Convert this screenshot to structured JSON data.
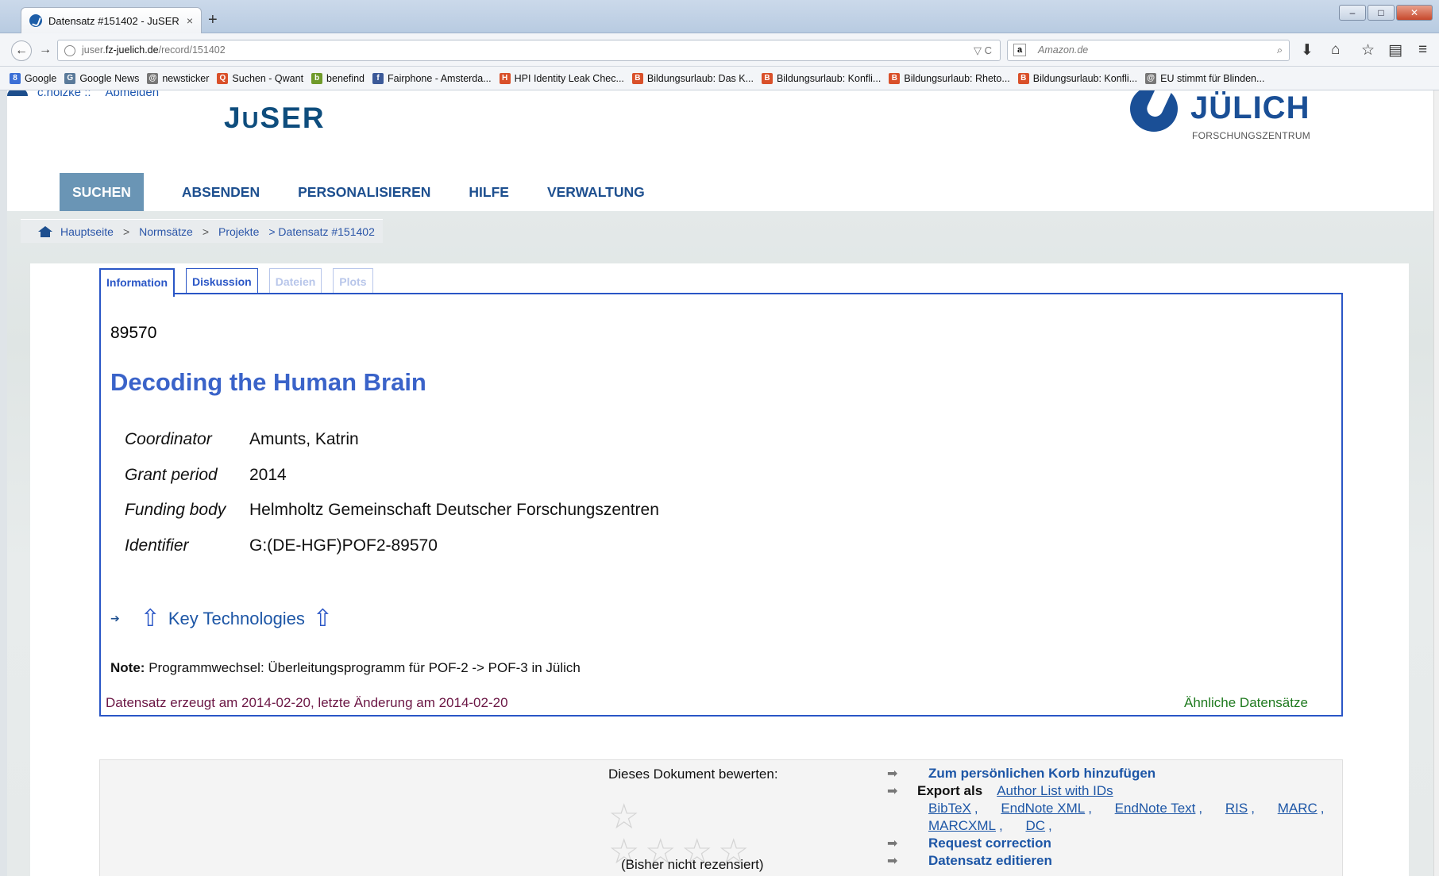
{
  "browser": {
    "tab_title": "Datensatz #151402 - JuSER",
    "tab_close": "×",
    "new_tab": "+",
    "url_prefix": "juser.",
    "url_host": "fz-juelich.de",
    "url_path": "/record/151402",
    "url_tools": "▽ C",
    "search_placeholder": "Amazon.de",
    "search_engine_glyph": "a",
    "win_min": "–",
    "win_max": "□",
    "win_close": "✕"
  },
  "bookmarks": [
    {
      "label": "Google",
      "color": "#3b6fd6",
      "glyph": "8"
    },
    {
      "label": "Google News",
      "color": "#5a7a9a",
      "glyph": "G"
    },
    {
      "label": "newsticker",
      "color": "#777777",
      "glyph": "@"
    },
    {
      "label": "Suchen - Qwant",
      "color": "#d9502a",
      "glyph": "Q"
    },
    {
      "label": "benefind",
      "color": "#6f9a2a",
      "glyph": "b"
    },
    {
      "label": "Fairphone - Amsterda...",
      "color": "#3b5998",
      "glyph": "f"
    },
    {
      "label": "HPI Identity Leak Chec...",
      "color": "#d9502a",
      "glyph": "H"
    },
    {
      "label": "Bildungsurlaub: Das K...",
      "color": "#d9502a",
      "glyph": "B"
    },
    {
      "label": "Bildungsurlaub: Konfli...",
      "color": "#d9502a",
      "glyph": "B"
    },
    {
      "label": "Bildungsurlaub: Rheto...",
      "color": "#d9502a",
      "glyph": "B"
    },
    {
      "label": "Bildungsurlaub: Konfli...",
      "color": "#d9502a",
      "glyph": "B"
    },
    {
      "label": "EU stimmt für Blinden...",
      "color": "#777777",
      "glyph": "@"
    }
  ],
  "header": {
    "user_name": "c.holzke ::",
    "logout": "Abmelden",
    "logo_main": "J",
    "logo_small": "U",
    "logo_rest": "SER",
    "partner_logo_name": "JÜLICH",
    "partner_logo_sub": "FORSCHUNGSZENTRUM"
  },
  "mainnav": [
    "SUCHEN",
    "ABSENDEN",
    "PERSONALISIEREN",
    "HILFE",
    "VERWALTUNG"
  ],
  "breadcrumb": {
    "home": "Hauptseite",
    "sep": ">",
    "level1": "Normsätze",
    "level2": "Projekte",
    "current": "> Datensatz #151402"
  },
  "record_tabs": [
    {
      "label": "Information",
      "state": "active"
    },
    {
      "label": "Diskussion",
      "state": "normal"
    },
    {
      "label": "Dateien",
      "state": "disabled"
    },
    {
      "label": "Plots",
      "state": "disabled"
    }
  ],
  "record": {
    "number": "89570",
    "title": "Decoding the Human Brain",
    "fields": [
      {
        "label": "Coordinator",
        "value": "Amunts, Katrin"
      },
      {
        "label": "Grant period",
        "value": "2014"
      },
      {
        "label": "Funding body",
        "value": "Helmholtz Gemeinschaft Deutscher Forschungszentren"
      },
      {
        "label": "Identifier",
        "value": "G:(DE-HGF)POF2-89570"
      }
    ],
    "parent_link": "Key Technologies",
    "note_label": "Note:",
    "note_text": "Programmwechsel: Überleitungsprogramm für POF-2 -> POF-3 in Jülich",
    "created_text": "Datensatz erzeugt am 2014-02-20, letzte Änderung am 2014-02-20",
    "similar_link": "Ähnliche Datensätze"
  },
  "rating": {
    "label": "Dieses Dokument bewerten:",
    "status": "(Bisher nicht rezensiert)"
  },
  "actions": {
    "add_basket": "Zum persönlichen Korb hinzufügen",
    "export_label": "Export als",
    "author_list": "Author List with IDs",
    "formats": [
      "BibTeX",
      "EndNote XML",
      "EndNote Text",
      "RIS",
      "MARC",
      "MARCXML",
      "DC"
    ],
    "request_correction": "Request correction",
    "edit_record": "Datensatz editieren"
  }
}
